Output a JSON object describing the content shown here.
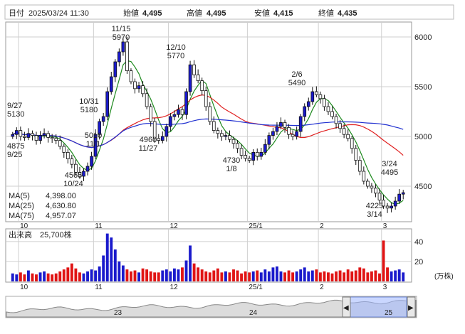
{
  "header": {
    "date_label": "日付",
    "date_value": "2025/03/24 11:30",
    "open_label": "始値",
    "open_value": "4,495",
    "high_label": "高値",
    "high_value": "4,495",
    "low_label": "安値",
    "low_value": "4,415",
    "close_label": "終値",
    "close_value": "4,435"
  },
  "colors": {
    "up": "#1a1acc",
    "down": "#e01414",
    "ma5": "#1f8a1f",
    "ma25": "#e02020",
    "ma75": "#2030d0",
    "high_value": "#e01414",
    "low_value": "#1f8a1f",
    "grid": "#cfcfcf",
    "navigator_sel": "#9fb6ff"
  },
  "chart_data": {
    "type": "candlestick",
    "price_axis": {
      "ticks": [
        4500,
        5000,
        5500,
        6000
      ]
    },
    "volume_axis": {
      "ticks": [
        20,
        40
      ],
      "unit": "(万株)"
    },
    "x_month_labels": [
      "10",
      "11",
      "12",
      "25/1",
      "2",
      "3"
    ],
    "closes": [
      5020,
      5060,
      5000,
      4990,
      5030,
      5010,
      4960,
      5010,
      5030,
      4990,
      4980,
      4960,
      4900,
      4840,
      4775,
      4720,
      4640,
      4600,
      4650,
      4700,
      4800,
      5020,
      5150,
      5200,
      5450,
      5600,
      5750,
      5850,
      5950,
      5660,
      5550,
      5480,
      5510,
      5430,
      5300,
      5150,
      4980,
      4960,
      5000,
      5100,
      5200,
      5220,
      5270,
      5220,
      5450,
      5720,
      5620,
      5560,
      5460,
      5300,
      5150,
      5060,
      5030,
      5000,
      5010,
      4970,
      4930,
      4880,
      4810,
      4780,
      4760,
      4840,
      4800,
      4840,
      4920,
      5010,
      5050,
      5100,
      5140,
      5090,
      5020,
      5000,
      5050,
      5200,
      5300,
      5350,
      5450,
      5420,
      5380,
      5300,
      5250,
      5200,
      5130,
      5080,
      5020,
      4980,
      4880,
      4760,
      4650,
      4550,
      4500,
      4480,
      4430,
      4360,
      4300,
      4280,
      4300,
      4350,
      4420,
      4435
    ],
    "month_tick_index": [
      2,
      21,
      40,
      60,
      78,
      94
    ],
    "volumes": [
      8,
      7,
      9,
      7,
      11,
      8,
      7,
      9,
      10,
      8,
      7,
      8,
      10,
      12,
      14,
      18,
      13,
      9,
      8,
      10,
      12,
      11,
      15,
      26,
      48,
      44,
      32,
      20,
      16,
      12,
      10,
      11,
      9,
      13,
      12,
      10,
      9,
      9,
      11,
      12,
      10,
      13,
      12,
      14,
      21,
      36,
      18,
      14,
      12,
      10,
      9,
      11,
      13,
      9,
      10,
      9,
      12,
      11,
      8,
      10,
      9,
      10,
      11,
      9,
      12,
      10,
      14,
      15,
      10,
      9,
      11,
      9,
      10,
      12,
      14,
      10,
      11,
      12,
      9,
      10,
      9,
      8,
      10,
      11,
      9,
      12,
      10,
      11,
      14,
      13,
      9,
      10,
      11,
      8,
      41,
      14,
      10,
      11,
      12,
      9
    ],
    "annotations": [
      {
        "label": "9/27",
        "value": "5130"
      },
      {
        "label": "9/25",
        "value": "4875"
      },
      {
        "label": "10/24",
        "value": "4565"
      },
      {
        "label": "10/31",
        "value": "5180"
      },
      {
        "label": "11/1",
        "value": "5010"
      },
      {
        "label": "11/15",
        "value": "5970"
      },
      {
        "label": "11/27",
        "value": "4960"
      },
      {
        "label": "12/10",
        "value": "5770"
      },
      {
        "label": "1/8",
        "value": "4730"
      },
      {
        "label": "2/6",
        "value": "5490"
      },
      {
        "label": "3/14",
        "value": "4225"
      },
      {
        "label": "3/24",
        "value": "4495"
      }
    ],
    "legend": [
      {
        "name": "MA(5)",
        "value": "4,398.00"
      },
      {
        "name": "MA(25)",
        "value": "4,630.80"
      },
      {
        "name": "MA(75)",
        "value": "4,957.07"
      }
    ],
    "volume_label": "出来高",
    "volume_value": "25,700株"
  },
  "navigator": {
    "year_labels": [
      "23",
      "24",
      "25"
    ],
    "left_arrow": "◀",
    "right_arrow": "▶"
  }
}
